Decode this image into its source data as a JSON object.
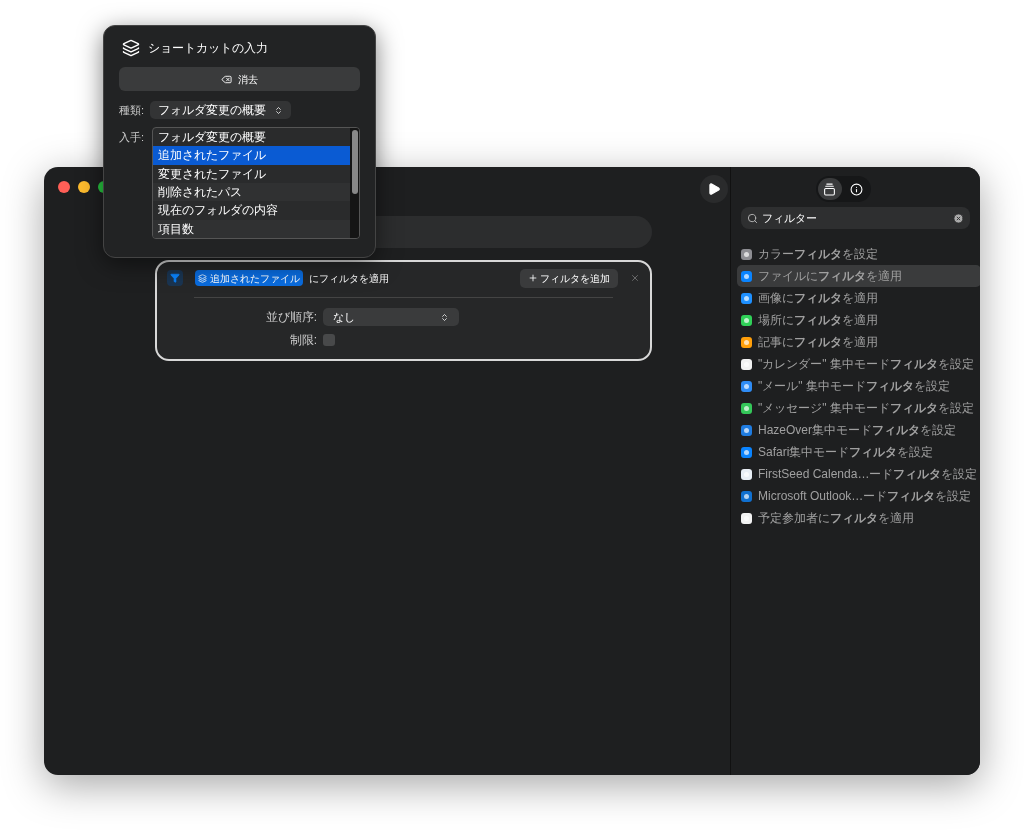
{
  "popover": {
    "title": "ショートカットの入力",
    "clear_button": "消去",
    "type_label": "種類:",
    "type_value": "フォルダ変更の概要",
    "get_label": "入手:",
    "get_options": [
      {
        "label": "フォルダ変更の概要",
        "selected": false
      },
      {
        "label": "追加されたファイル",
        "selected": true
      },
      {
        "label": "変更されたファイル",
        "selected": false
      },
      {
        "label": "削除されたパス",
        "selected": false
      },
      {
        "label": "現在のフォルダの内容",
        "selected": false
      },
      {
        "label": "項目数",
        "selected": false
      }
    ]
  },
  "action_card": {
    "variable": "追加されたファイル",
    "text": "にフィルタを適用",
    "add_filter_button": "フィルタを追加",
    "sort_label": "並び順序:",
    "sort_value": "なし",
    "limit_label": "制限:",
    "limit_checked": false
  },
  "sidebar": {
    "search": {
      "value": "フィルター"
    },
    "actions": [
      {
        "label": "カラー**フィルタ**を設定",
        "color": "#8e8e93",
        "selected": false
      },
      {
        "label": "ファイルに**フィルタ**を適用",
        "color": "#0a84ff",
        "selected": true
      },
      {
        "label": "画像に**フィルタ**を適用",
        "color": "#1e90ff",
        "selected": false
      },
      {
        "label": "場所に**フィルタ**を適用",
        "color": "#30d158",
        "selected": false
      },
      {
        "label": "記事に**フィルタ**を適用",
        "color": "#ff9f0a",
        "selected": false
      },
      {
        "label": "\"カレンダー\" 集中モード**フィルタ**を設定",
        "color": "#f2f2f2",
        "selected": false
      },
      {
        "label": "\"メール\" 集中モード**フィルタ**を設定",
        "color": "#2f8cf5",
        "selected": false
      },
      {
        "label": "\"メッセージ\" 集中モード**フィルタ**を設定",
        "color": "#34c759",
        "selected": false
      },
      {
        "label": "HazeOver集中モード**フィルタ**を設定",
        "color": "#1f7ce0",
        "selected": false
      },
      {
        "label": "Safari集中モード**フィルタ**を設定",
        "color": "#0a84ff",
        "selected": false
      },
      {
        "label": "FirstSeed Calenda…ード**フィルタ**を設定",
        "color": "#e8eef5",
        "selected": false
      },
      {
        "label": "Microsoft Outlook…ード**フィルタ**を設定",
        "color": "#1070d0",
        "selected": false
      },
      {
        "label": "予定参加者に**フィルタ**を適用",
        "color": "#f2f2f2",
        "selected": false
      }
    ]
  }
}
